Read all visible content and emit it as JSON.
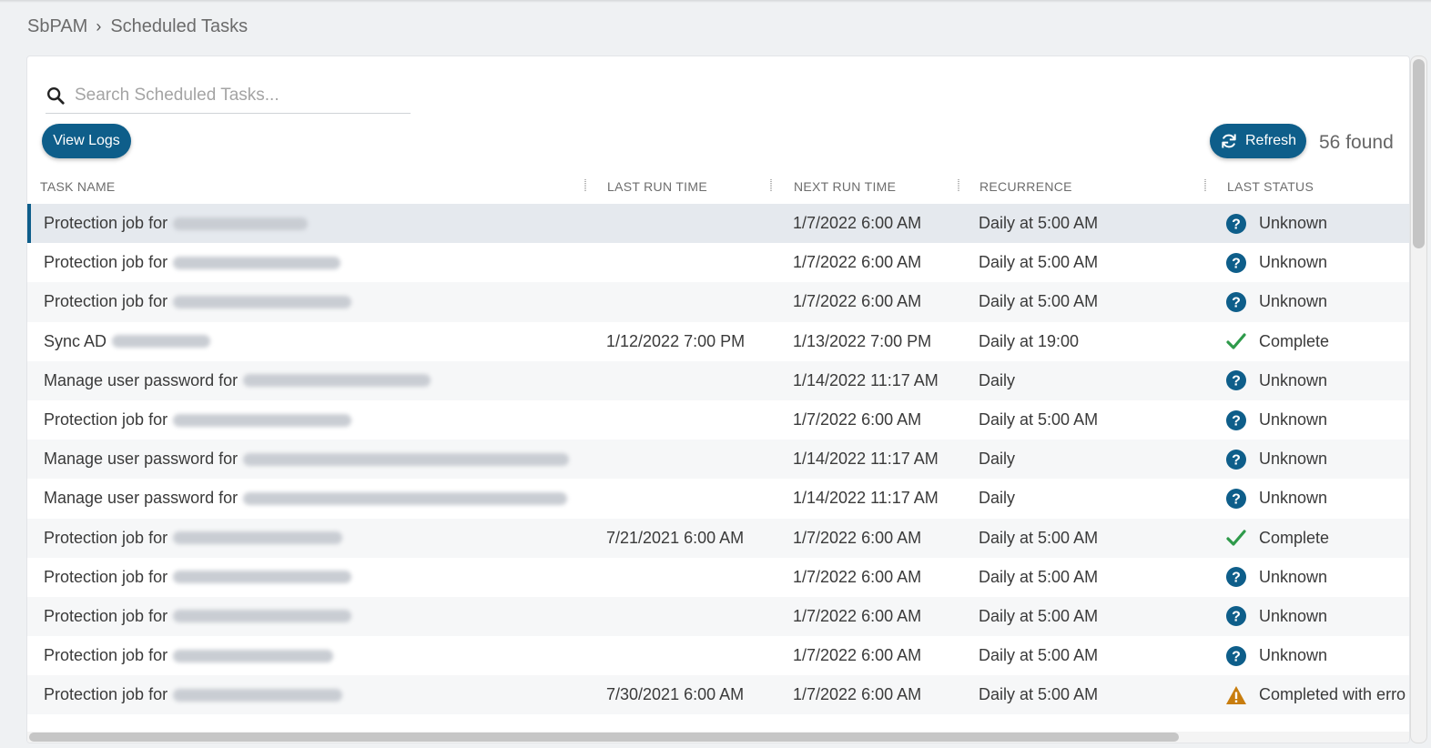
{
  "breadcrumb": {
    "root": "SbPAM",
    "current": "Scheduled Tasks"
  },
  "search": {
    "placeholder": "Search Scheduled Tasks..."
  },
  "toolbar": {
    "view_logs_label": "View Logs",
    "refresh_label": "Refresh",
    "found_count": "56 found"
  },
  "columns": [
    "TASK NAME",
    "LAST RUN TIME",
    "NEXT RUN TIME",
    "RECURRENCE",
    "LAST STATUS"
  ],
  "rows": [
    {
      "task": "Protection job for",
      "last_run": "",
      "next_run": "1/7/2022 6:00 AM",
      "recurrence": "Daily at 5:00 AM",
      "status": "Unknown",
      "status_icon": "question-icon"
    },
    {
      "task": "Protection job for",
      "last_run": "",
      "next_run": "1/7/2022 6:00 AM",
      "recurrence": "Daily at 5:00 AM",
      "status": "Unknown",
      "status_icon": "question-icon"
    },
    {
      "task": "Protection job for",
      "last_run": "",
      "next_run": "1/7/2022 6:00 AM",
      "recurrence": "Daily at 5:00 AM",
      "status": "Unknown",
      "status_icon": "question-icon"
    },
    {
      "task": "Sync AD",
      "last_run": "1/12/2022 7:00 PM",
      "next_run": "1/13/2022 7:00 PM",
      "recurrence": "Daily at 19:00",
      "status": "Complete",
      "status_icon": "check-icon"
    },
    {
      "task": "Manage user password for",
      "last_run": "",
      "next_run": "1/14/2022 11:17 AM",
      "recurrence": "Daily",
      "status": "Unknown",
      "status_icon": "question-icon"
    },
    {
      "task": "Protection job for",
      "last_run": "",
      "next_run": "1/7/2022 6:00 AM",
      "recurrence": "Daily at 5:00 AM",
      "status": "Unknown",
      "status_icon": "question-icon"
    },
    {
      "task": "Manage user password for",
      "last_run": "",
      "next_run": "1/14/2022 11:17 AM",
      "recurrence": "Daily",
      "status": "Unknown",
      "status_icon": "question-icon"
    },
    {
      "task": "Manage user password for",
      "last_run": "",
      "next_run": "1/14/2022 11:17 AM",
      "recurrence": "Daily",
      "status": "Unknown",
      "status_icon": "question-icon"
    },
    {
      "task": "Protection job for",
      "last_run": "7/21/2021 6:00 AM",
      "next_run": "1/7/2022 6:00 AM",
      "recurrence": "Daily at 5:00 AM",
      "status": "Complete",
      "status_icon": "check-icon"
    },
    {
      "task": "Protection job for",
      "last_run": "",
      "next_run": "1/7/2022 6:00 AM",
      "recurrence": "Daily at 5:00 AM",
      "status": "Unknown",
      "status_icon": "question-icon"
    },
    {
      "task": "Protection job for",
      "last_run": "",
      "next_run": "1/7/2022 6:00 AM",
      "recurrence": "Daily at 5:00 AM",
      "status": "Unknown",
      "status_icon": "question-icon"
    },
    {
      "task": "Protection job for",
      "last_run": "",
      "next_run": "1/7/2022 6:00 AM",
      "recurrence": "Daily at 5:00 AM",
      "status": "Unknown",
      "status_icon": "question-icon"
    },
    {
      "task": "Protection job for",
      "last_run": "7/30/2021 6:00 AM",
      "next_run": "1/7/2022 6:00 AM",
      "recurrence": "Daily at 5:00 AM",
      "status": "Completed with erro",
      "status_icon": "warning-icon"
    }
  ],
  "colors": {
    "accent": "#0e5e8a",
    "unknown": "#0e5e8a",
    "complete": "#2e9a4a",
    "warning": "#c87d0e"
  }
}
